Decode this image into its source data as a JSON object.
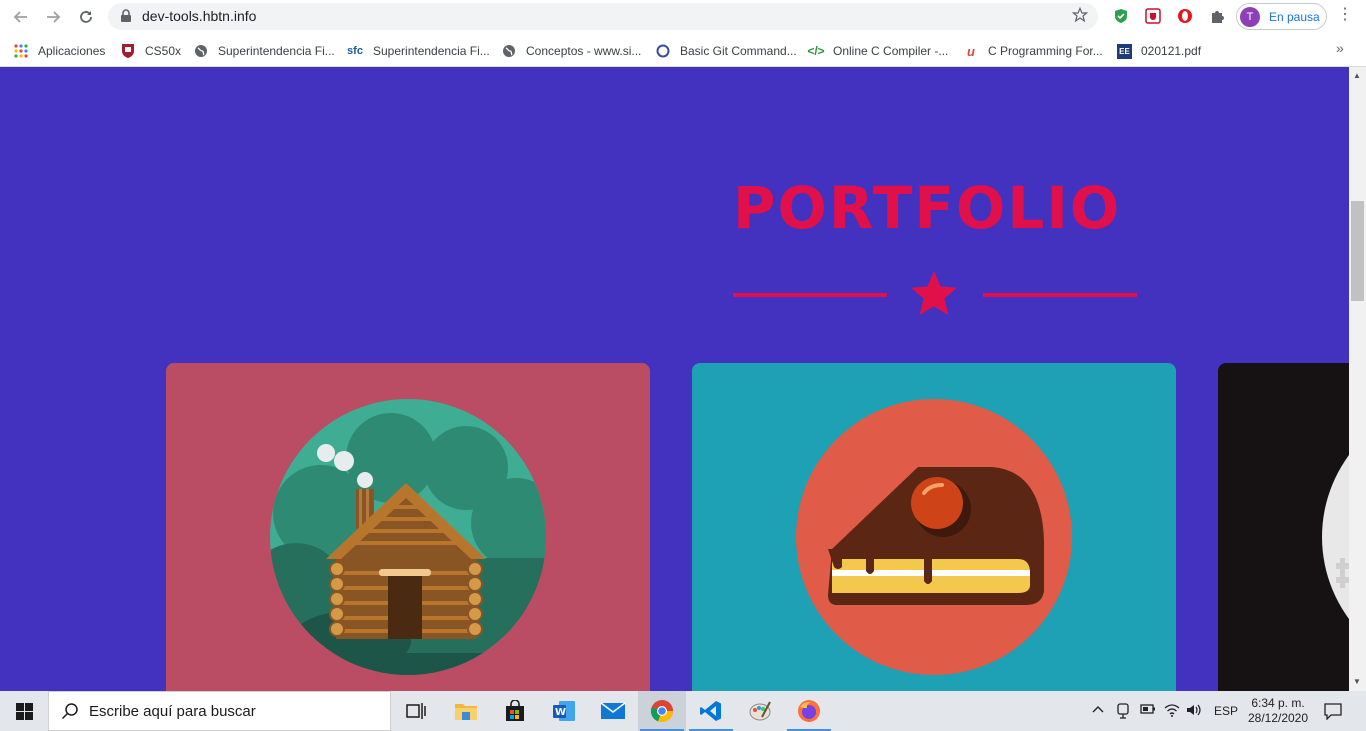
{
  "browser": {
    "url": "dev-tools.hbtn.info",
    "profile_initial": "T",
    "profile_label": "En pausa"
  },
  "bookmarks": [
    {
      "label": "Aplicaciones",
      "icon": "apps-grid-icon"
    },
    {
      "label": "CS50x",
      "icon": "harvard-shield-icon"
    },
    {
      "label": "Superintendencia Fi...",
      "icon": "globe-icon"
    },
    {
      "label": "Superintendencia Fi...",
      "icon": "sfc-logo-icon"
    },
    {
      "label": "Conceptos - www.si...",
      "icon": "globe-icon"
    },
    {
      "label": "Basic Git Command...",
      "icon": "ring-icon"
    },
    {
      "label": "Online C Compiler -...",
      "icon": "code-icon"
    },
    {
      "label": "C Programming For...",
      "icon": "udemy-icon"
    },
    {
      "label": "020121.pdf",
      "icon": "ee-icon"
    }
  ],
  "page": {
    "heading": "PORTFOLIO",
    "colors": {
      "background": "#4232bf",
      "accent": "#e1104b",
      "card_1": "#ba4d64",
      "card_2": "#1ea1b4",
      "card_3": "#161112"
    },
    "cards": [
      {
        "illustration": "log-cabin-illustration"
      },
      {
        "illustration": "cake-slice-illustration"
      },
      {
        "illustration": "partial-illustration"
      }
    ]
  },
  "taskbar": {
    "search_placeholder": "Escribe aquí para buscar",
    "apps": [
      "task-view-icon",
      "file-explorer-icon",
      "store-icon",
      "word-icon",
      "mail-icon",
      "chrome-icon",
      "vscode-icon",
      "paint-icon",
      "firefox-icon"
    ],
    "language": "ESP",
    "time": "6:34 p. m.",
    "date": "28/12/2020"
  }
}
